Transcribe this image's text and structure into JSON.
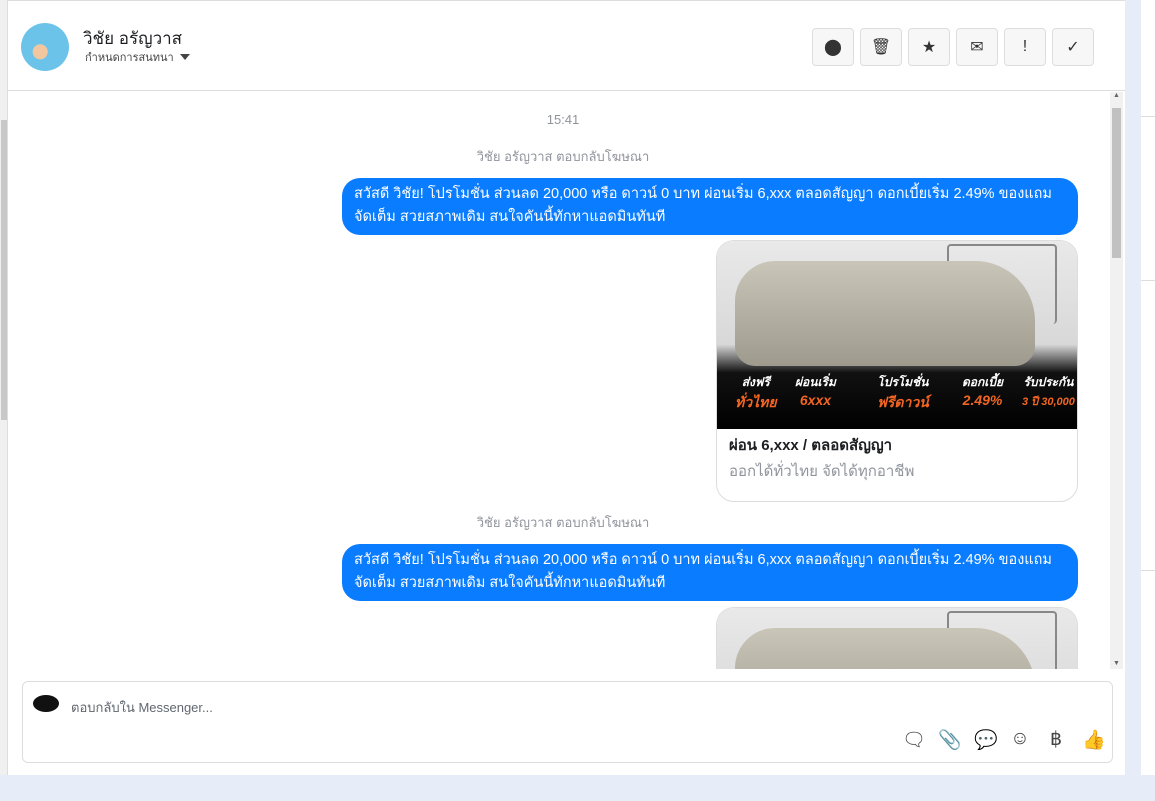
{
  "header": {
    "name": "วิชัย อรัญวาส",
    "subtitle": "กำหนดการสนทนา"
  },
  "toolbar": [
    {
      "icon": "alert-circle-icon",
      "glyph": "❗"
    },
    {
      "icon": "trash-icon",
      "glyph": "🗑"
    },
    {
      "icon": "star-icon",
      "glyph": "★"
    },
    {
      "icon": "envelope-icon",
      "glyph": "✉"
    },
    {
      "icon": "exclamation-icon",
      "glyph": "!"
    },
    {
      "icon": "check-icon",
      "glyph": "✓"
    }
  ],
  "messages": {
    "time": "15:41",
    "items": [
      {
        "note": "วิชัย อรัญวาส ตอบกลับโฆษณา",
        "text": "สวัสดี วิชัย! โปรโมชั่น ส่วนลด 20,000 หรือ ดาวน์ 0 บาท ผ่อนเริ่ม 6,xxx ตลอดสัญญา ดอกเบี้ยเริ่ม 2.49% ของแถมจัดเต็ม สวยสภาพเดิม สนใจคันนี้ทักหาแอดมินทันที",
        "card_title": "ผ่อน 6,xxx / ตลอดสัญญา",
        "card_desc": "ออกได้ทั่วไทย จัดได้ทุกอาชีพ"
      },
      {
        "note": "วิชัย อรัญวาส ตอบกลับโฆษณา",
        "text": "สวัสดี วิชัย! โปรโมชั่น ส่วนลด 20,000 หรือ ดาวน์ 0 บาท ผ่อนเริ่ม 6,xxx ตลอดสัญญา ดอกเบี้ยเริ่ม 2.49% ของแถมจัดเต็ม สวยสภาพเดิม สนใจคันนี้ทักหาแอดมินทันที"
      }
    ],
    "promo": [
      {
        "a": "ส่งฟรี",
        "b": "ทั่วไทย"
      },
      {
        "a": "ผ่อนเริ่ม",
        "b": "6xxx"
      },
      {
        "a": "โปรโมชั่น",
        "b": "ฟรีดาวน์"
      },
      {
        "a": "ดอกเบี้ย",
        "b": "2.49%"
      },
      {
        "a": "รับประกัน",
        "b": "3 ปี 30,000"
      }
    ]
  },
  "composer": {
    "placeholder": "ตอบกลับใน Messenger...",
    "icons": [
      "saved-reply-icon",
      "paperclip-icon",
      "chat-bubble-icon",
      "emoji-icon",
      "baht-icon",
      "thumbs-up-icon"
    ]
  }
}
